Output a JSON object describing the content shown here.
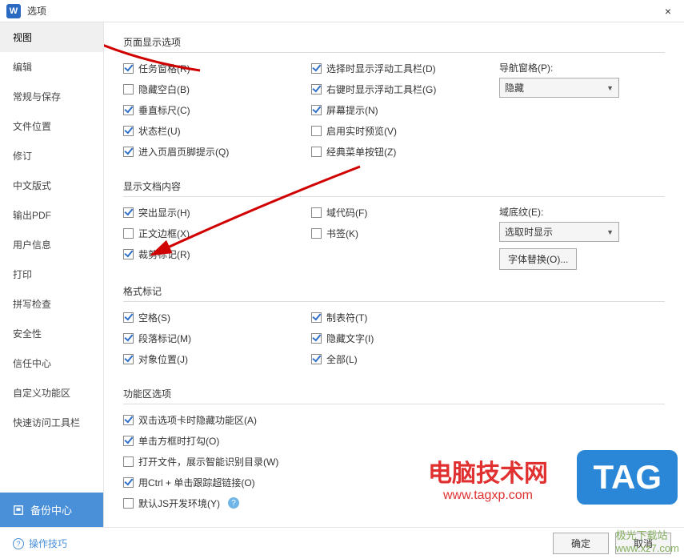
{
  "titlebar": {
    "app_letter": "W",
    "title": "选项",
    "close": "×"
  },
  "sidebar": {
    "items": [
      "视图",
      "编辑",
      "常规与保存",
      "文件位置",
      "修订",
      "中文版式",
      "输出PDF",
      "用户信息",
      "打印",
      "拼写检查",
      "安全性",
      "信任中心",
      "自定义功能区",
      "快速访问工具栏"
    ],
    "selected_index": 0,
    "backup_label": "备份中心"
  },
  "sections": {
    "page_display": {
      "title": "页面显示选项"
    },
    "doc_content": {
      "title": "显示文档内容"
    },
    "format_marks": {
      "title": "格式标记"
    },
    "ribbon": {
      "title": "功能区选项"
    }
  },
  "checks": {
    "task_pane": {
      "label": "任务窗格(R)",
      "checked": true
    },
    "hide_blank": {
      "label": "隐藏空白(B)",
      "checked": false
    },
    "v_ruler": {
      "label": "垂直标尺(C)",
      "checked": true
    },
    "status_bar": {
      "label": "状态栏(U)",
      "checked": true
    },
    "header_footer": {
      "label": "进入页眉页脚提示(Q)",
      "checked": true
    },
    "float_select": {
      "label": "选择时显示浮动工具栏(D)",
      "checked": true
    },
    "float_right": {
      "label": "右键时显示浮动工具栏(G)",
      "checked": true
    },
    "screen_tips": {
      "label": "屏幕提示(N)",
      "checked": true
    },
    "live_preview": {
      "label": "启用实时预览(V)",
      "checked": false
    },
    "classic_menu": {
      "label": "经典菜单按钮(Z)",
      "checked": false
    },
    "highlight": {
      "label": "突出显示(H)",
      "checked": true
    },
    "text_border": {
      "label": "正文边框(X)",
      "checked": false
    },
    "crop_marks": {
      "label": "裁剪标记(R)",
      "checked": true
    },
    "field_codes": {
      "label": "域代码(F)",
      "checked": false
    },
    "bookmarks": {
      "label": "书签(K)",
      "checked": false
    },
    "spaces": {
      "label": "空格(S)",
      "checked": true
    },
    "para_marks": {
      "label": "段落标记(M)",
      "checked": true
    },
    "obj_pos": {
      "label": "对象位置(J)",
      "checked": true
    },
    "tabs": {
      "label": "制表符(T)",
      "checked": true
    },
    "hidden_text": {
      "label": "隐藏文字(I)",
      "checked": true
    },
    "all": {
      "label": "全部(L)",
      "checked": true
    },
    "dbl_click_hide": {
      "label": "双击选项卡时隐藏功能区(A)",
      "checked": true
    },
    "click_check": {
      "label": "单击方框时打勾(O)",
      "checked": true
    },
    "open_show_toc": {
      "label": "打开文件，展示智能识别目录(W)",
      "checked": false
    },
    "ctrl_link": {
      "label": "用Ctrl + 单击跟踪超链接(O)",
      "checked": true
    },
    "js_dev": {
      "label": "默认JS开发环境(Y)",
      "checked": false
    }
  },
  "nav_pane": {
    "label": "导航窗格(P):",
    "value": "隐藏"
  },
  "field_shade": {
    "label": "域底纹(E):",
    "value": "选取时显示"
  },
  "font_sub_btn": "字体替换(O)...",
  "footer": {
    "tips": "操作技巧",
    "ok": "确定",
    "cancel": "取消"
  },
  "watermarks": {
    "w1_line1": "电脑技术网",
    "w1_line2": "www.tagxp.com",
    "w2": "TAG",
    "w3a": "极光下载站",
    "w3b": "www.xz7.com"
  }
}
